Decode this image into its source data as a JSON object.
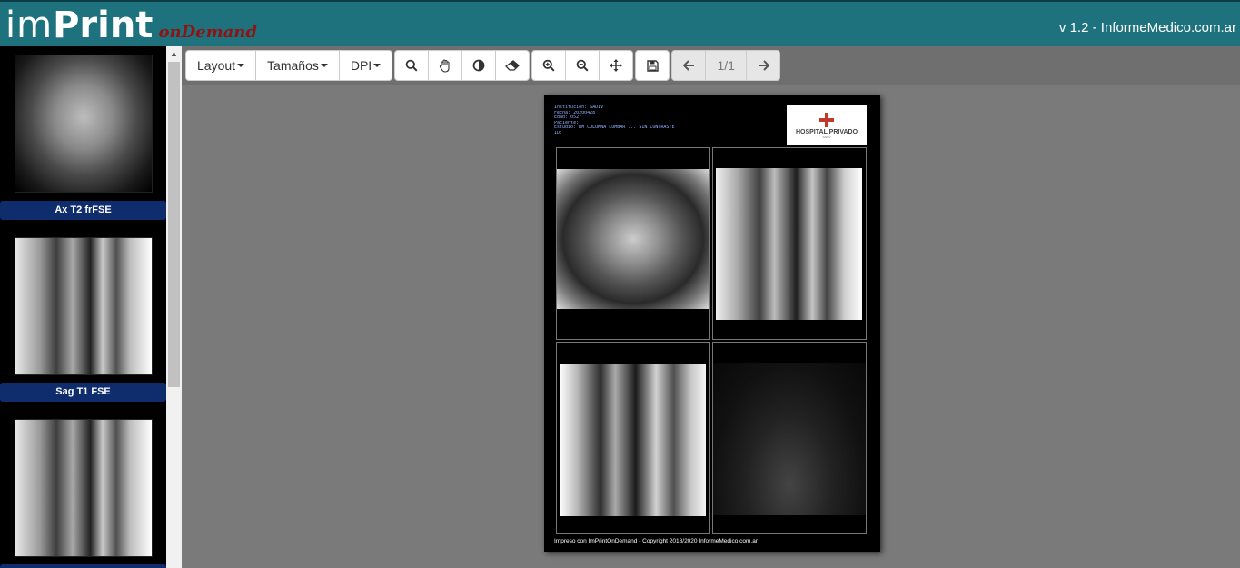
{
  "header": {
    "logo_im": "im",
    "logo_print": "Print",
    "logo_ondemand": "onDemand",
    "version": "v 1.2 - InformeMedico.com.ar"
  },
  "sidebar": {
    "series": [
      {
        "label": "Ax T2 frFSE",
        "kind": "axial"
      },
      {
        "label": "Sag T1 FSE",
        "kind": "sagittal"
      },
      {
        "label": "",
        "kind": "sagittal"
      }
    ]
  },
  "toolbar": {
    "layout_label": "Layout",
    "sizes_label": "Tamaños",
    "dpi_label": "DPI",
    "page_indicator": "1/1",
    "icons": [
      "search-icon",
      "hand-icon",
      "contrast-icon",
      "eraser-icon",
      "zoom-in-icon",
      "zoom-out-icon",
      "move-icon",
      "save-icon",
      "arrow-left-icon",
      "arrow-right-icon"
    ]
  },
  "sheet": {
    "metadata_lines": [
      "Institución: SADIV",
      "Fecha: 20200428",
      "Edad: 052Y",
      "Paciente: ______",
      "Estudio: RM COLUMNA LUMBAR ... SIN CONTRASTE",
      "ID: ______"
    ],
    "hospital_name": "HOSPITAL PRIVADO",
    "hospital_sub": "SADIV",
    "footer": "Impreso con ImPrintOnDemand - Copyright 2018/2020 InformeMedico.com.ar"
  },
  "colors": {
    "header_bg": "#1d727e",
    "label_bg": "#0f2c6d",
    "logo_accent": "#8e1414"
  }
}
